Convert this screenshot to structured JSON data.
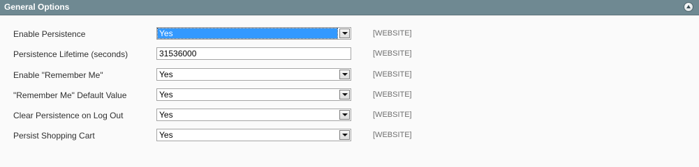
{
  "section": {
    "title": "General Options"
  },
  "rows": [
    {
      "label": "Enable Persistence",
      "type": "select",
      "value": "Yes",
      "scope": "[WEBSITE]"
    },
    {
      "label": "Persistence Lifetime (seconds)",
      "type": "text",
      "value": "31536000",
      "scope": "[WEBSITE]"
    },
    {
      "label": "Enable \"Remember Me\"",
      "type": "select",
      "value": "Yes",
      "scope": "[WEBSITE]"
    },
    {
      "label": "\"Remember Me\" Default Value",
      "type": "select",
      "value": "Yes",
      "scope": "[WEBSITE]"
    },
    {
      "label": "Clear Persistence on Log Out",
      "type": "select",
      "value": "Yes",
      "scope": "[WEBSITE]"
    },
    {
      "label": "Persist Shopping Cart",
      "type": "select",
      "value": "Yes",
      "scope": "[WEBSITE]"
    }
  ],
  "icons": {
    "collapse": "collapse-up-icon",
    "dropdown": "chevron-down-icon"
  },
  "colors": {
    "header_bg": "#6f8992",
    "focus_highlight": "#3399ff"
  }
}
